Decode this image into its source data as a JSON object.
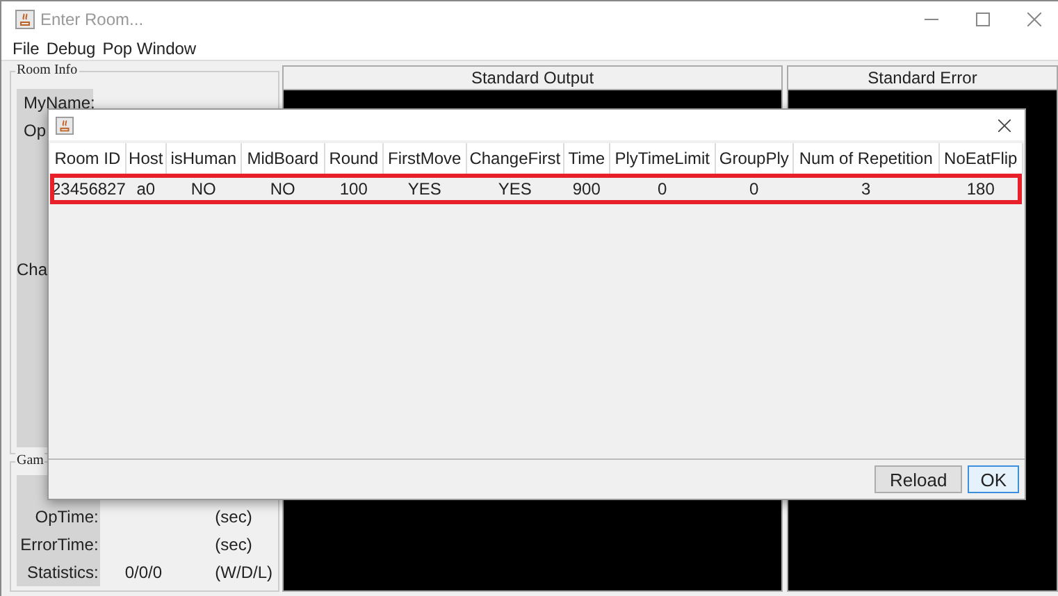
{
  "window": {
    "title": "Enter Room..."
  },
  "menu": [
    "File",
    "Debug",
    "Pop Window"
  ],
  "room_info": {
    "title": "Room Info",
    "labels": [
      "MyName:",
      "Op",
      "Cha"
    ]
  },
  "game_info": {
    "title": "Gam",
    "rows": [
      {
        "label": "OpTime:",
        "unit": "(sec)"
      },
      {
        "label": "ErrorTime:",
        "unit": "(sec)"
      },
      {
        "label": "Statistics:",
        "value": "0/0/0",
        "unit": "(W/D/L)"
      }
    ]
  },
  "panels": [
    {
      "title": "Standard Output"
    },
    {
      "title": "Standard Error"
    }
  ],
  "dialog": {
    "columns": [
      "Room ID",
      "Host",
      "isHuman",
      "MidBoard",
      "Round",
      "FirstMove",
      "ChangeFirst",
      "Time",
      "PlyTimeLimit",
      "GroupPly",
      "Num of Repetition",
      "NoEatFlip"
    ],
    "rows": [
      {
        "cells": [
          "23456827",
          "a0",
          "NO",
          "NO",
          "100",
          "YES",
          "YES",
          "900",
          "0",
          "0",
          "3",
          "180"
        ],
        "selected": true
      }
    ],
    "buttons": [
      {
        "label": "Reload",
        "focused": false
      },
      {
        "label": "OK",
        "focused": true
      }
    ]
  }
}
